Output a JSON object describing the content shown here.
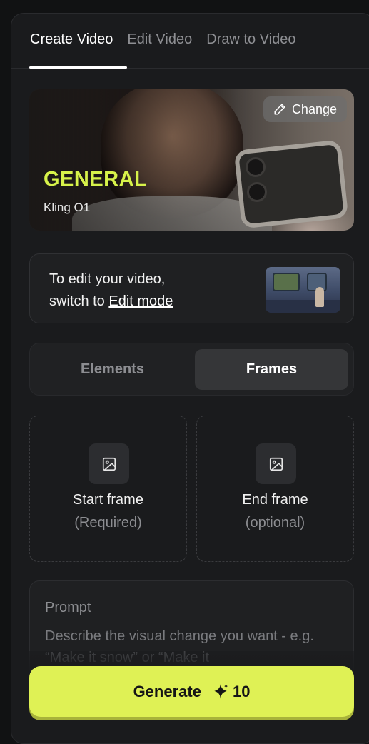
{
  "tabs": [
    {
      "label": "Create Video",
      "active": true
    },
    {
      "label": "Edit Video",
      "active": false
    },
    {
      "label": "Draw to Video",
      "active": false
    }
  ],
  "model_card": {
    "name": "GENERAL",
    "version": "Kling O1",
    "change_label": "Change",
    "change_icon": "pencil-icon",
    "accent_color": "#d7f24a"
  },
  "edit_notice": {
    "line1": "To edit your video,",
    "line2_prefix": "switch to ",
    "link_text": "Edit mode"
  },
  "mode_toggle": {
    "options": [
      "Elements",
      "Frames"
    ],
    "selected": "Frames"
  },
  "frames": {
    "start": {
      "label": "Start frame",
      "sub": "(Required)",
      "icon": "image-icon"
    },
    "end": {
      "label": "End frame",
      "sub": "(optional)",
      "icon": "image-icon"
    }
  },
  "prompt": {
    "label": "Prompt",
    "placeholder": "Describe the visual change you want - e.g. “Make it snow” or “Make it"
  },
  "generate": {
    "label": "Generate",
    "cost": "10",
    "cost_icon": "sparkle-icon",
    "color": "#dff155"
  }
}
